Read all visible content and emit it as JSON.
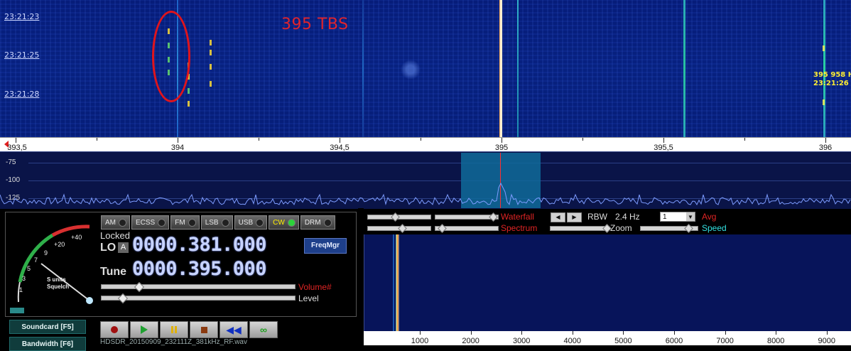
{
  "waterfall_top": {
    "time_labels": [
      "23:21:23",
      "23:21:25",
      "23:21:28"
    ],
    "annotation_text": "395 TBS",
    "marker_freq": "395 958 H",
    "marker_time": "23:21:26"
  },
  "freq_scale": {
    "labels": [
      "393,5",
      "394",
      "394,5",
      "395",
      "395,5",
      "396"
    ]
  },
  "spectrum": {
    "db_labels": [
      "-75",
      "-100",
      "-125"
    ]
  },
  "modes": [
    {
      "label": "AM",
      "active": false
    },
    {
      "label": "ECSS",
      "active": false
    },
    {
      "label": "FM",
      "active": false
    },
    {
      "label": "LSB",
      "active": false
    },
    {
      "label": "USB",
      "active": false
    },
    {
      "label": "CW",
      "active": true
    },
    {
      "label": "DRM",
      "active": false
    }
  ],
  "smeter": {
    "scale_labels": [
      "+40",
      "+20",
      "9",
      "7",
      "5",
      "3",
      "1"
    ],
    "caption_line1": "S units",
    "caption_line2": "Squelch"
  },
  "lo": {
    "locked_label": "Locked",
    "label": "LO",
    "badge": "A",
    "value": "0000.381.000"
  },
  "tune": {
    "label": "Tune",
    "value": "0000.395.000"
  },
  "freqmgr_label": "FreqMgr",
  "volume_label": "Volume#",
  "level_label": "Level",
  "side_buttons": {
    "soundcard": "Soundcard  [F5]",
    "bandwidth": "Bandwidth  [F6]"
  },
  "filename": "HDSDR_20150909_232111Z_381kHz_RF.wav",
  "right_panel": {
    "waterfall_label": "Waterfall",
    "spectrum_label": "Spectrum",
    "rbw_label": "RBW",
    "rbw_value": "2.4 Hz",
    "avg_value": "1",
    "avg_label": "Avg",
    "zoom_label": "Zoom",
    "speed_label": "Speed"
  },
  "audio_scale": {
    "labels": [
      "1000",
      "2000",
      "3000",
      "4000",
      "5000",
      "6000",
      "7000",
      "8000",
      "9000"
    ]
  },
  "colors": {
    "waterfall_bg": "#061c7a",
    "annotation_red": "#e0242c",
    "marker_yellow": "#ffee33",
    "readout_blue": "#c8d4ff",
    "active_mode_yellow": "#ffee00",
    "led_green": "#2cd33a",
    "speed_cyan": "#33e0e0"
  }
}
